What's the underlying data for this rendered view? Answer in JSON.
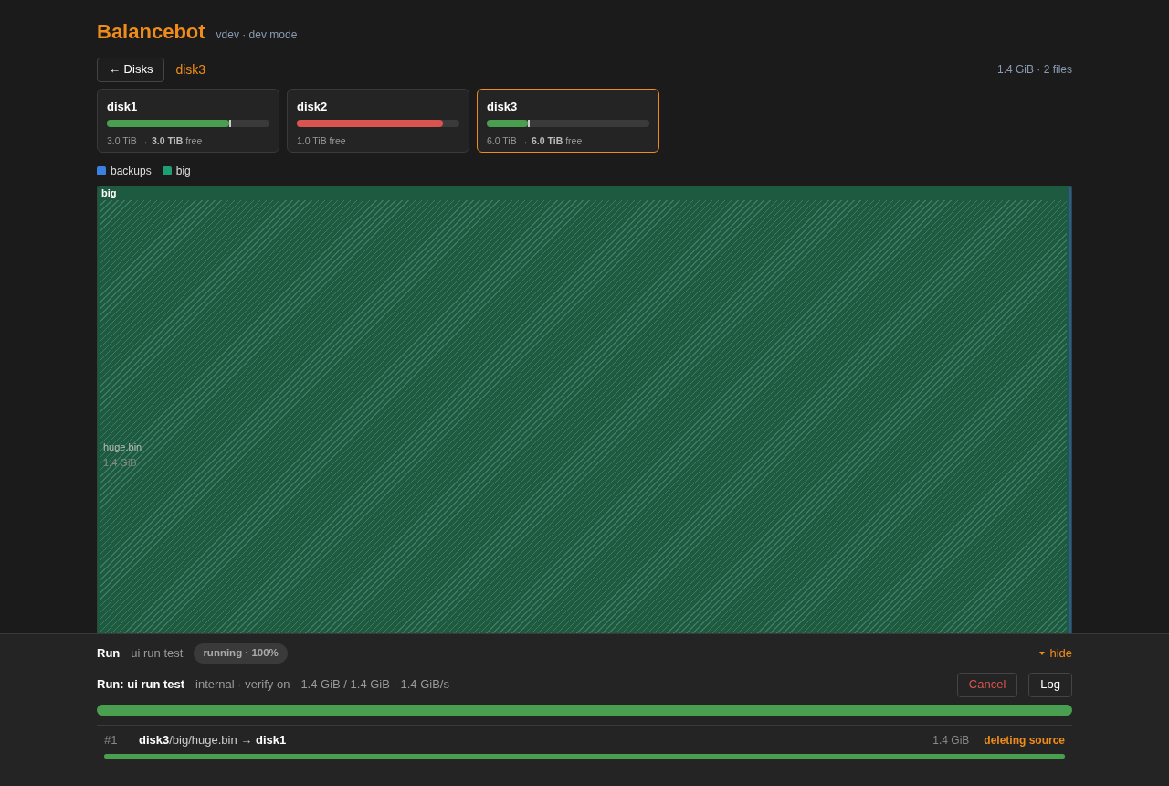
{
  "header": {
    "title": "Balancebot",
    "version": "vdev · dev mode"
  },
  "nav": {
    "back_button": "← Disks",
    "current": "disk3",
    "summary": "1.4 GiB · 2 files"
  },
  "disks": [
    {
      "name": "disk1",
      "color": "#4a9e4f",
      "level": 0.75,
      "marker": true,
      "selected": false,
      "before": "3.0 TiB → ",
      "after": "3.0 TiB",
      "suffix": " free"
    },
    {
      "name": "disk2",
      "color": "#d9534f",
      "level": 0.9,
      "marker": false,
      "selected": false,
      "before": "1.0 TiB free"
    },
    {
      "name": "disk3",
      "color": "#4a9e4f",
      "level": 0.25,
      "marker": true,
      "selected": true,
      "before": "6.0 TiB → ",
      "after": "6.0 TiB",
      "suffix": " free"
    }
  ],
  "legend": [
    {
      "label": "backups",
      "color": "#3b82e0"
    },
    {
      "label": "big",
      "color": "#1f9e74"
    }
  ],
  "treemap": {
    "group": "big",
    "file_name": "huge.bin",
    "file_size": "1.4 GiB"
  },
  "run_panel": {
    "title": "Run",
    "name": "ui run test",
    "status": "running · 100%",
    "toggle": "hide",
    "heading": "Run: ui run test",
    "mode": "internal · verify on",
    "progress_text": "1.4 GiB / 1.4 GiB · 1.4 GiB/s",
    "cancel_button": "Cancel",
    "log_button": "Log",
    "level": 1.0,
    "transfers": [
      {
        "index": "#1",
        "source_disk": "disk3",
        "path": "/big/huge.bin → ",
        "target_disk": "disk1",
        "size": "1.4 GiB",
        "status": "deleting source",
        "level": 1.0
      }
    ]
  }
}
